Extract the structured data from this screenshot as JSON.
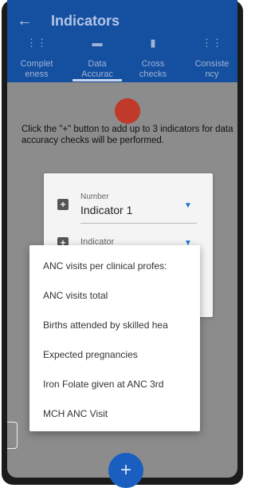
{
  "header": {
    "back_icon": "arrow-left-icon",
    "title": "Indicators"
  },
  "tabs": [
    {
      "icon": "completeness-icon",
      "line1": "Complet",
      "line2": "eness"
    },
    {
      "icon": "laptop-icon",
      "line1": "Data",
      "line2": "Accurac"
    },
    {
      "icon": "cross-checks-icon",
      "line1": "Cross",
      "line2": "checks"
    },
    {
      "icon": "consistency-icon",
      "line1": "Consiste",
      "line2": "ncy"
    }
  ],
  "selected_tab": "Data Accurac",
  "helper_text": "Click the \"+\" button to add up to 3 indicators for data accuracy checks will be performed.",
  "card": {
    "number_label": "Number",
    "number_value": "Indicator 1",
    "indicator_label": "Indicator"
  },
  "menu_items": [
    "ANC visits per clinical profes:",
    "ANC visits total",
    "Births attended by skilled hea",
    "Expected pregnancies",
    "Iron Folate given at ANC 3rd",
    "MCH ANC Visit"
  ],
  "fab_label": "+",
  "colors": {
    "appbar": "#144fa0",
    "accent": "#1f6fd0",
    "status_dot": "#c0392b",
    "overlay_bg": "#8c8c8c"
  }
}
